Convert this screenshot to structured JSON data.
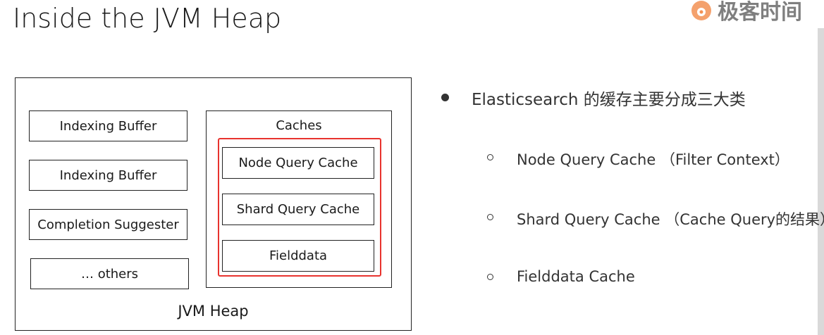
{
  "slide": {
    "title": "Inside the JVM Heap",
    "logo_text": "极客时间"
  },
  "diagram": {
    "outer_label": "JVM Heap",
    "left_boxes": [
      "Indexing Buffer",
      "Indexing Buffer",
      "Completion Suggester",
      "… others"
    ],
    "caches_label": "Caches",
    "cache_boxes": [
      "Node Query Cache",
      "Shard Query Cache",
      "Fielddata"
    ],
    "highlight_color": "#e8332e"
  },
  "notes": {
    "main": "Elasticsearch 的缓存主要分成三大类",
    "items": [
      "Node Query Cache （Filter Context）",
      "Shard Query Cache （Cache Query的结果）",
      "Fielddata Cache"
    ]
  }
}
